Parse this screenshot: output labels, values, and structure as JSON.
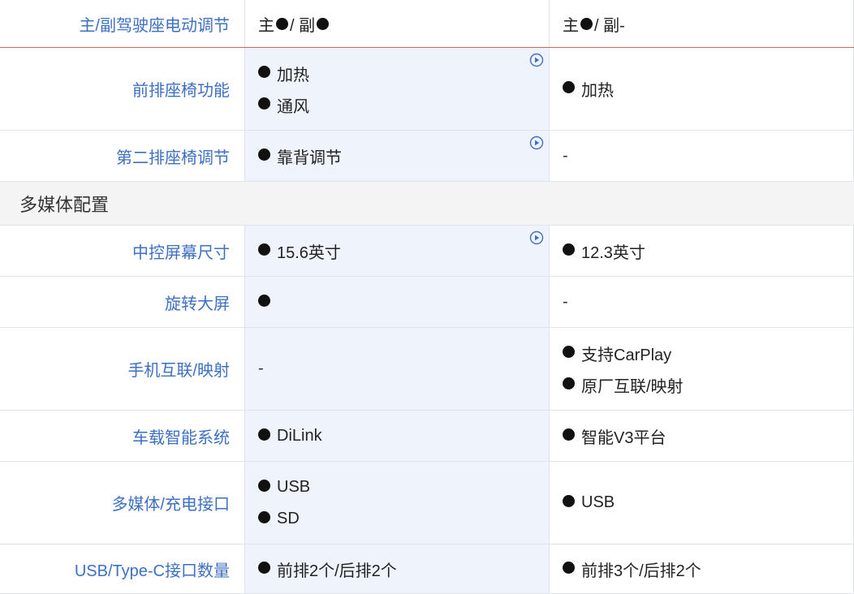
{
  "rows": [
    {
      "label": "主/副驾驶座电动调节"
    },
    {
      "label": "前排座椅功能",
      "a": [
        "加热",
        "通风"
      ],
      "b": [
        "加热"
      ]
    },
    {
      "label": "第二排座椅调节",
      "a": [
        "靠背调节"
      ],
      "b_dash": "-"
    },
    {
      "label": "中控屏幕尺寸",
      "a": [
        "15.6英寸"
      ],
      "b": [
        "12.3英寸"
      ]
    },
    {
      "label": "旋转大屏",
      "b_dash": "-"
    },
    {
      "label": "手机互联/映射",
      "a_dash": "-",
      "b": [
        "支持CarPlay",
        "原厂互联/映射"
      ]
    },
    {
      "label": "车载智能系统",
      "a": [
        "DiLink"
      ],
      "b": [
        "智能V3平台"
      ]
    },
    {
      "label": "多媒体/充电接口",
      "a": [
        "USB",
        "SD"
      ],
      "b": [
        "USB"
      ]
    },
    {
      "label": "USB/Type-C接口数量",
      "a": [
        "前排2个/后排2个"
      ],
      "b": [
        "前排3个/后排2个"
      ]
    }
  ],
  "first_row": {
    "a_main": "主",
    "a_sep": " / 副",
    "b_main": "主",
    "b_sep": " / 副-"
  },
  "section": {
    "title": "多媒体配置"
  },
  "icons": {
    "video": "play-circle-icon",
    "dot": "filled-dot-icon"
  },
  "colors": {
    "label": "#3d6fc4",
    "highlight_col": "#eff3fb",
    "first_row_border": "#e25c5c"
  }
}
